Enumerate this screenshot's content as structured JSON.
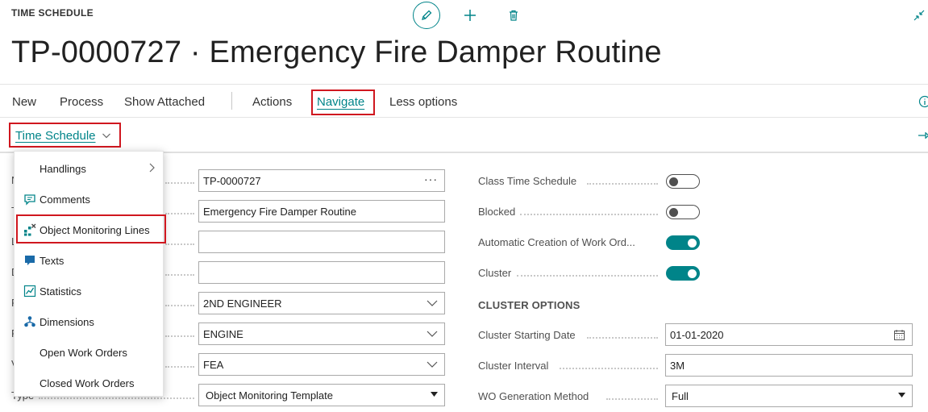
{
  "header": {
    "page_type": "TIME SCHEDULE",
    "title": "TP-0000727 · Emergency Fire Damper Routine"
  },
  "actionbar": {
    "new": "New",
    "process": "Process",
    "show_attached": "Show Attached",
    "actions": "Actions",
    "navigate": "Navigate",
    "less_options": "Less options"
  },
  "subbar": {
    "time_schedule": "Time Schedule"
  },
  "menu": {
    "items": [
      {
        "label": "Handlings",
        "icon": "none",
        "submenu": true
      },
      {
        "label": "Comments",
        "icon": "comment-icon"
      },
      {
        "label": "Object Monitoring Lines",
        "icon": "object-monitoring-icon"
      },
      {
        "label": "Texts",
        "icon": "text-icon"
      },
      {
        "label": "Statistics",
        "icon": "statistics-icon"
      },
      {
        "label": "Dimensions",
        "icon": "dimensions-icon"
      },
      {
        "label": "Open Work Orders",
        "icon": "none"
      },
      {
        "label": "Closed Work Orders",
        "icon": "none"
      }
    ]
  },
  "left_form": {
    "partial_labels": [
      "N",
      "T",
      "L",
      "D",
      "F",
      "F",
      "V"
    ],
    "type_label": "Type",
    "no_value": "TP-0000727",
    "description_value": "Emergency Fire Damper Routine",
    "field3_value": "",
    "field4_value": "",
    "responsible_value": "2ND ENGINEER",
    "department_value": "ENGINE",
    "w_value": "FEA",
    "type_value": "Object Monitoring Template"
  },
  "right_form": {
    "class_time_schedule_label": "Class Time Schedule",
    "class_time_schedule_on": false,
    "blocked_label": "Blocked",
    "blocked_on": false,
    "auto_creation_label": "Automatic Creation of Work Ord...",
    "auto_creation_on": true,
    "cluster_label": "Cluster",
    "cluster_on": true,
    "cluster_options_heading": "CLUSTER OPTIONS",
    "cluster_start_label": "Cluster Starting Date",
    "cluster_start_value": "01-01-2020",
    "cluster_interval_label": "Cluster Interval",
    "cluster_interval_value": "3M",
    "wo_method_label": "WO Generation Method",
    "wo_method_value": "Full"
  },
  "colors": {
    "accent": "#008489",
    "highlight": "#d0171f",
    "text": "#212121"
  }
}
